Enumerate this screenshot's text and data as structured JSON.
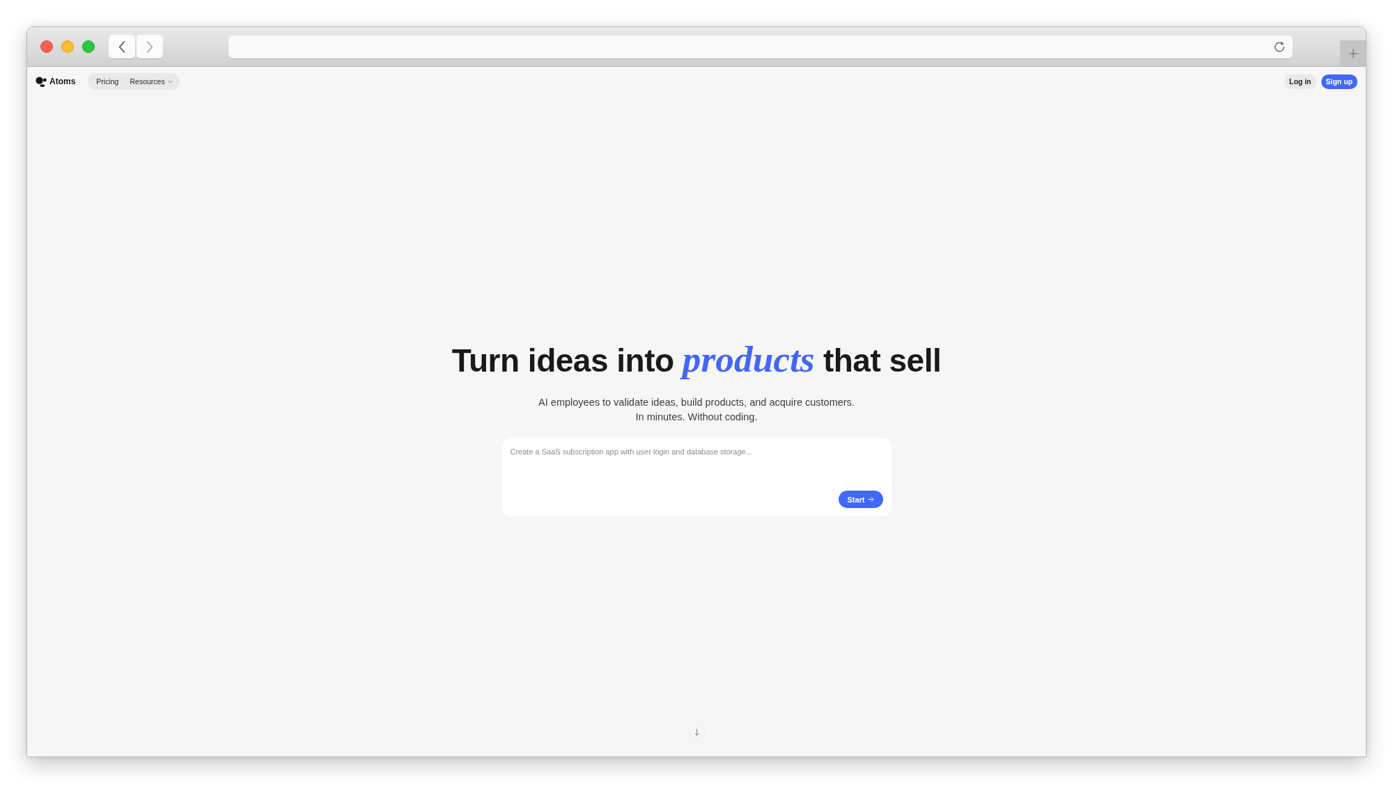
{
  "browser": {
    "back_button": {
      "disabled": false
    },
    "forward_button": {
      "disabled": true
    }
  },
  "nav": {
    "logo": {
      "label": "Atoms"
    },
    "links": [
      {
        "label": "Pricing",
        "kind": "link"
      },
      {
        "label": "Resources",
        "kind": "dropdown"
      }
    ],
    "actions": [
      {
        "label": "Log in",
        "kind": "secondary"
      },
      {
        "label": "Sign up",
        "kind": "primary"
      }
    ]
  },
  "hero": {
    "title": "Turn ideas into *products* that sell",
    "subtitle": [
      "AI employees to validate ideas, build products, and acquire customers.",
      "In minutes. Without coding."
    ]
  },
  "prompt": {
    "placeholder": "Create a SaaS subscription app with user login and database storage...",
    "submit": {
      "label": "Start"
    }
  }
}
